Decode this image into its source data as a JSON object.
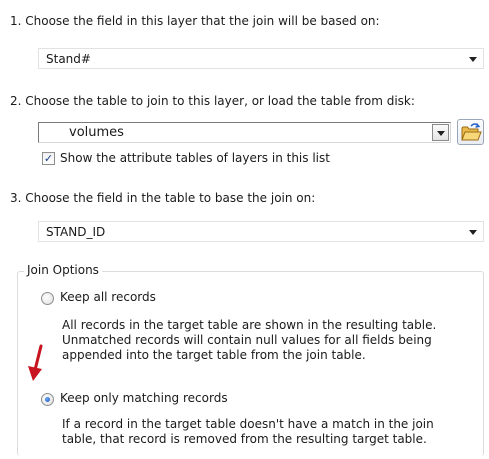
{
  "step1": {
    "label": "1.  Choose the field in this layer that the join will be based on:",
    "field_value": "Stand#"
  },
  "step2": {
    "label": "2.  Choose the table to join to this layer, or load the table from disk:",
    "table_value": "volumes",
    "show_attr_checkbox": {
      "label": "Show the attribute tables of layers in this list",
      "checked": true
    },
    "load_icon": "open-folder-icon"
  },
  "step3": {
    "label": "3.  Choose the field in the table to base the join on:",
    "field_value": "STAND_ID"
  },
  "join_options": {
    "legend": "Join Options",
    "keep_all": {
      "label": "Keep all records",
      "selected": false,
      "description": [
        "All records in the target table are shown in the resulting table.",
        "Unmatched records will contain null values for all fields being",
        "appended into the target table from the join table."
      ]
    },
    "keep_matching": {
      "label": "Keep only matching records",
      "selected": true,
      "description": [
        "If a record in the target table doesn't have a match in the join",
        "table, that record is removed from the resulting target table."
      ]
    }
  },
  "colors": {
    "annotation_arrow": "#c8141e",
    "radio_selected": "#1b4fa8"
  },
  "annotation": {
    "icon": "red-arrow-icon"
  }
}
